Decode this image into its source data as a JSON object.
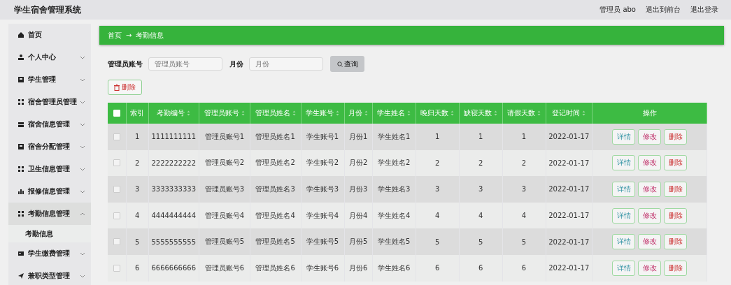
{
  "header": {
    "title": "学生宿舍管理系统",
    "user": "管理员 abo",
    "links": [
      "退出到前台",
      "退出登录"
    ]
  },
  "sidebar": {
    "items": [
      {
        "label": "首页",
        "has_arrow": false,
        "expanded": false
      },
      {
        "label": "个人中心",
        "has_arrow": true,
        "expanded": false
      },
      {
        "label": "学生管理",
        "has_arrow": true,
        "expanded": false
      },
      {
        "label": "宿舍管理员管理",
        "has_arrow": true,
        "expanded": false
      },
      {
        "label": "宿舍信息管理",
        "has_arrow": true,
        "expanded": false
      },
      {
        "label": "宿舍分配管理",
        "has_arrow": true,
        "expanded": false
      },
      {
        "label": "卫生信息管理",
        "has_arrow": true,
        "expanded": false
      },
      {
        "label": "报修信息管理",
        "has_arrow": true,
        "expanded": false
      },
      {
        "label": "考勤信息管理",
        "has_arrow": true,
        "expanded": true,
        "children": [
          {
            "label": "考勤信息",
            "selected": true
          }
        ]
      },
      {
        "label": "学生缴费管理",
        "has_arrow": true,
        "expanded": false
      },
      {
        "label": "兼职类型管理",
        "has_arrow": true,
        "expanded": false
      }
    ]
  },
  "breadcrumb": {
    "home": "首页",
    "separator": "→",
    "current": "考勤信息"
  },
  "search": {
    "fields": [
      {
        "label": "管理员账号",
        "placeholder": "管理员账号"
      },
      {
        "label": "月份",
        "placeholder": "月份"
      }
    ],
    "button": "查询"
  },
  "delete_button": "删除",
  "table": {
    "all_checked": false,
    "columns": [
      {
        "label": "索引",
        "sortable": false
      },
      {
        "label": "考勤编号",
        "sortable": true
      },
      {
        "label": "管理员账号",
        "sortable": true
      },
      {
        "label": "管理员姓名",
        "sortable": true
      },
      {
        "label": "学生账号",
        "sortable": true
      },
      {
        "label": "月份",
        "sortable": true
      },
      {
        "label": "学生姓名",
        "sortable": true
      },
      {
        "label": "晚归天数",
        "sortable": true
      },
      {
        "label": "缺寝天数",
        "sortable": true
      },
      {
        "label": "请假天数",
        "sortable": true
      },
      {
        "label": "登记时间",
        "sortable": true
      },
      {
        "label": "操作",
        "sortable": false
      }
    ],
    "rows": [
      {
        "checked": false,
        "cells": [
          "1",
          "1111111111",
          "管理员账号1",
          "管理员姓名1",
          "学生账号1",
          "月份1",
          "学生姓名1",
          "1",
          "1",
          "1",
          "2022-01-17"
        ],
        "actions": [
          "详情",
          "修改",
          "删除"
        ]
      },
      {
        "checked": false,
        "cells": [
          "2",
          "2222222222",
          "管理员账号2",
          "管理员姓名2",
          "学生账号2",
          "月份2",
          "学生姓名2",
          "2",
          "2",
          "2",
          "2022-01-17"
        ],
        "actions": [
          "详情",
          "修改",
          "删除"
        ]
      },
      {
        "checked": false,
        "cells": [
          "3",
          "3333333333",
          "管理员账号3",
          "管理员姓名3",
          "学生账号3",
          "月份3",
          "学生姓名3",
          "3",
          "3",
          "3",
          "2022-01-17"
        ],
        "actions": [
          "详情",
          "修改",
          "删除"
        ]
      },
      {
        "checked": false,
        "cells": [
          "4",
          "4444444444",
          "管理员账号4",
          "管理员姓名4",
          "学生账号4",
          "月份4",
          "学生姓名4",
          "4",
          "4",
          "4",
          "2022-01-17"
        ],
        "actions": [
          "详情",
          "修改",
          "删除"
        ]
      },
      {
        "checked": false,
        "cells": [
          "5",
          "5555555555",
          "管理员账号5",
          "管理员姓名5",
          "学生账号5",
          "月份5",
          "学生姓名5",
          "5",
          "5",
          "5",
          "2022-01-17"
        ],
        "actions": [
          "详情",
          "修改",
          "删除"
        ]
      },
      {
        "checked": false,
        "cells": [
          "6",
          "6666666666",
          "管理员账号6",
          "管理员姓名6",
          "学生账号6",
          "月份6",
          "学生姓名6",
          "6",
          "6",
          "6",
          "2022-01-17"
        ],
        "actions": [
          "详情",
          "修改",
          "删除"
        ]
      }
    ]
  }
}
